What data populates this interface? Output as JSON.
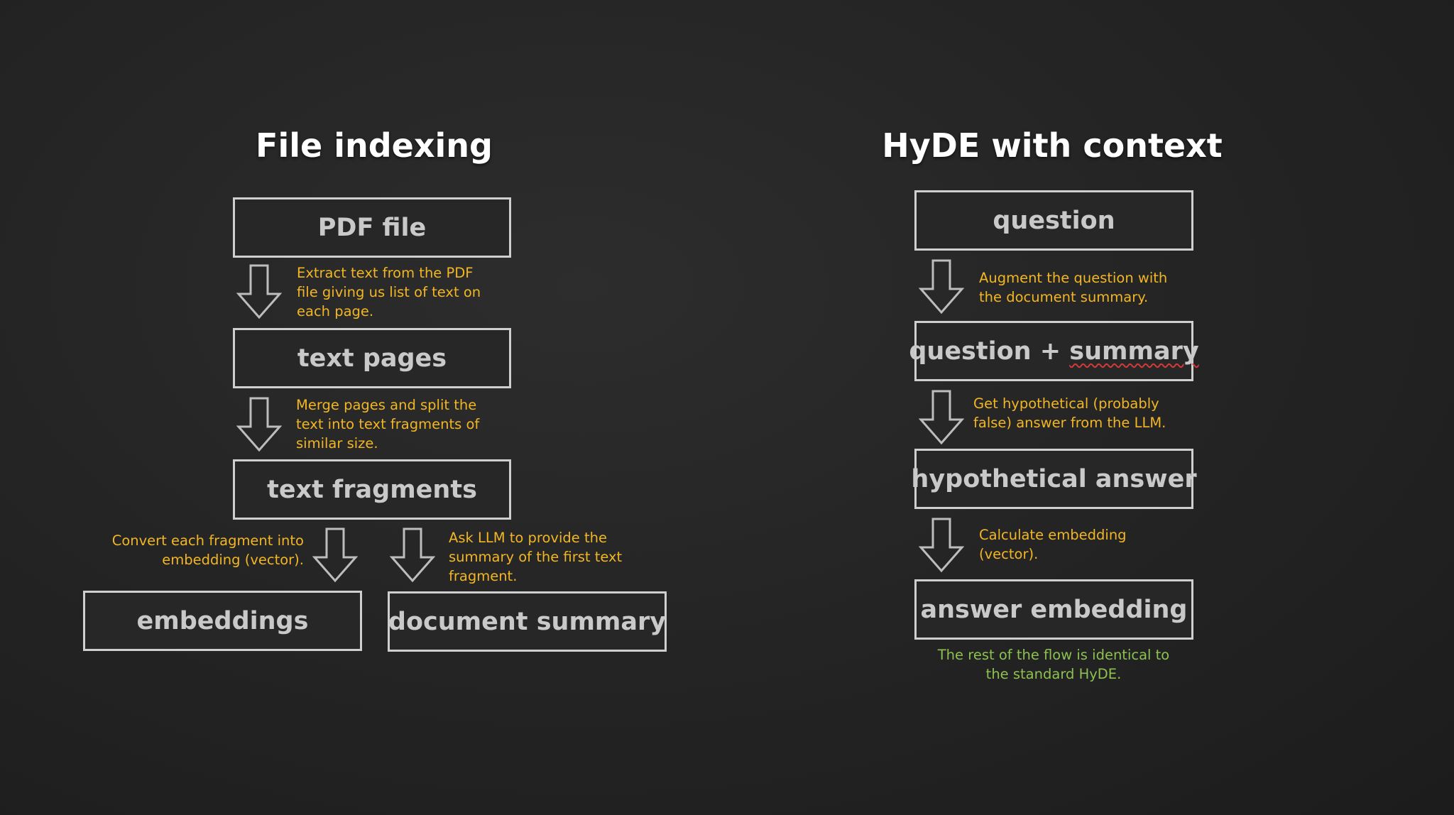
{
  "left": {
    "title": "File indexing",
    "boxes": {
      "pdf": "PDF file",
      "pages": "text pages",
      "fragments": "text fragments",
      "embeddings": "embeddings",
      "summary": "document summary"
    },
    "notes": {
      "extract": "Extract text from the PDF\nfile giving us list of text on\neach page.",
      "merge": "Merge pages and split the\ntext into text fragments of\nsimilar size.",
      "convert": "Convert each fragment into\nembedding (vector).",
      "ask": "Ask LLM to provide the\nsummary of the first text\nfragment."
    }
  },
  "right": {
    "title": "HyDE with context",
    "boxes": {
      "question": "question",
      "question_plus": "question + ",
      "summary_word": "summary",
      "hypothetical": "hypothetical answer",
      "answer_embedding": "answer embedding"
    },
    "notes": {
      "augment": "Augment the question with\nthe document summary.",
      "get": "Get hypothetical (probably\nfalse) answer from the LLM.",
      "calculate": "Calculate embedding\n(vector).",
      "rest": "The rest of the flow is identical to\nthe standard HyDE."
    }
  },
  "colors": {
    "note": "#f2b624",
    "footnote": "#8cc152",
    "box_border": "#cfcfcf",
    "box_text": "#c9c9c9",
    "title": "#ffffff"
  }
}
